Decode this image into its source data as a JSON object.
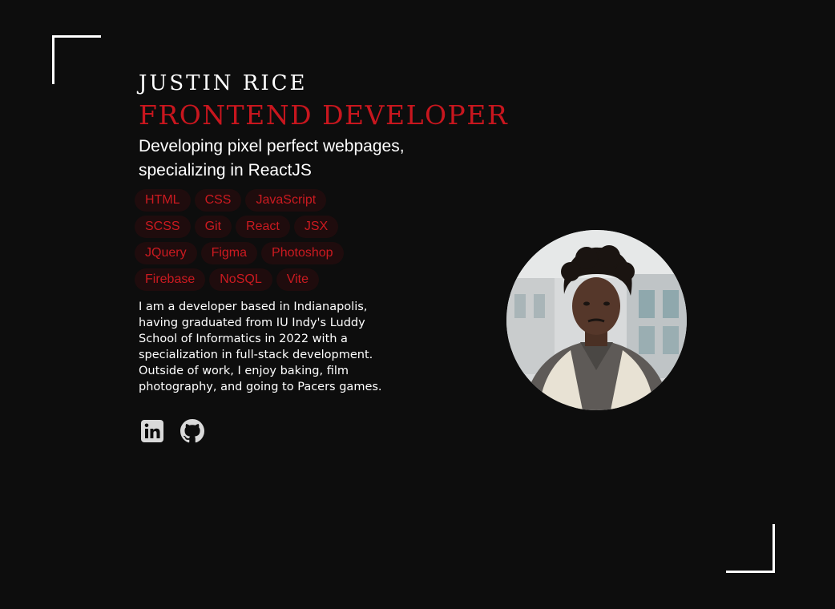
{
  "hero": {
    "name": "JUSTIN RICE",
    "role": "FRONTEND DEVELOPER",
    "tagline": "Developing pixel perfect webpages, specializing in ReactJS",
    "skills": [
      "HTML",
      "CSS",
      "JavaScript",
      "SCSS",
      "Git",
      "React",
      "JSX",
      "JQuery",
      "Figma",
      "Photoshop",
      "Firebase",
      "NoSQL",
      "Vite"
    ],
    "bio": "I am a developer based in Indianapolis, having graduated from IU Indy's Luddy School of Informatics in 2022 with a specialization in full-stack development. Outside of work, I enjoy baking, film photography, and going to Pacers games."
  },
  "socials": [
    {
      "icon": "linkedin-icon"
    },
    {
      "icon": "github-icon"
    }
  ],
  "colors": {
    "background": "#0d0d0d",
    "accent": "#c8161e",
    "tag_bg": "#1f0c0d",
    "text": "#ffffff",
    "icon": "#d9d9d9"
  }
}
